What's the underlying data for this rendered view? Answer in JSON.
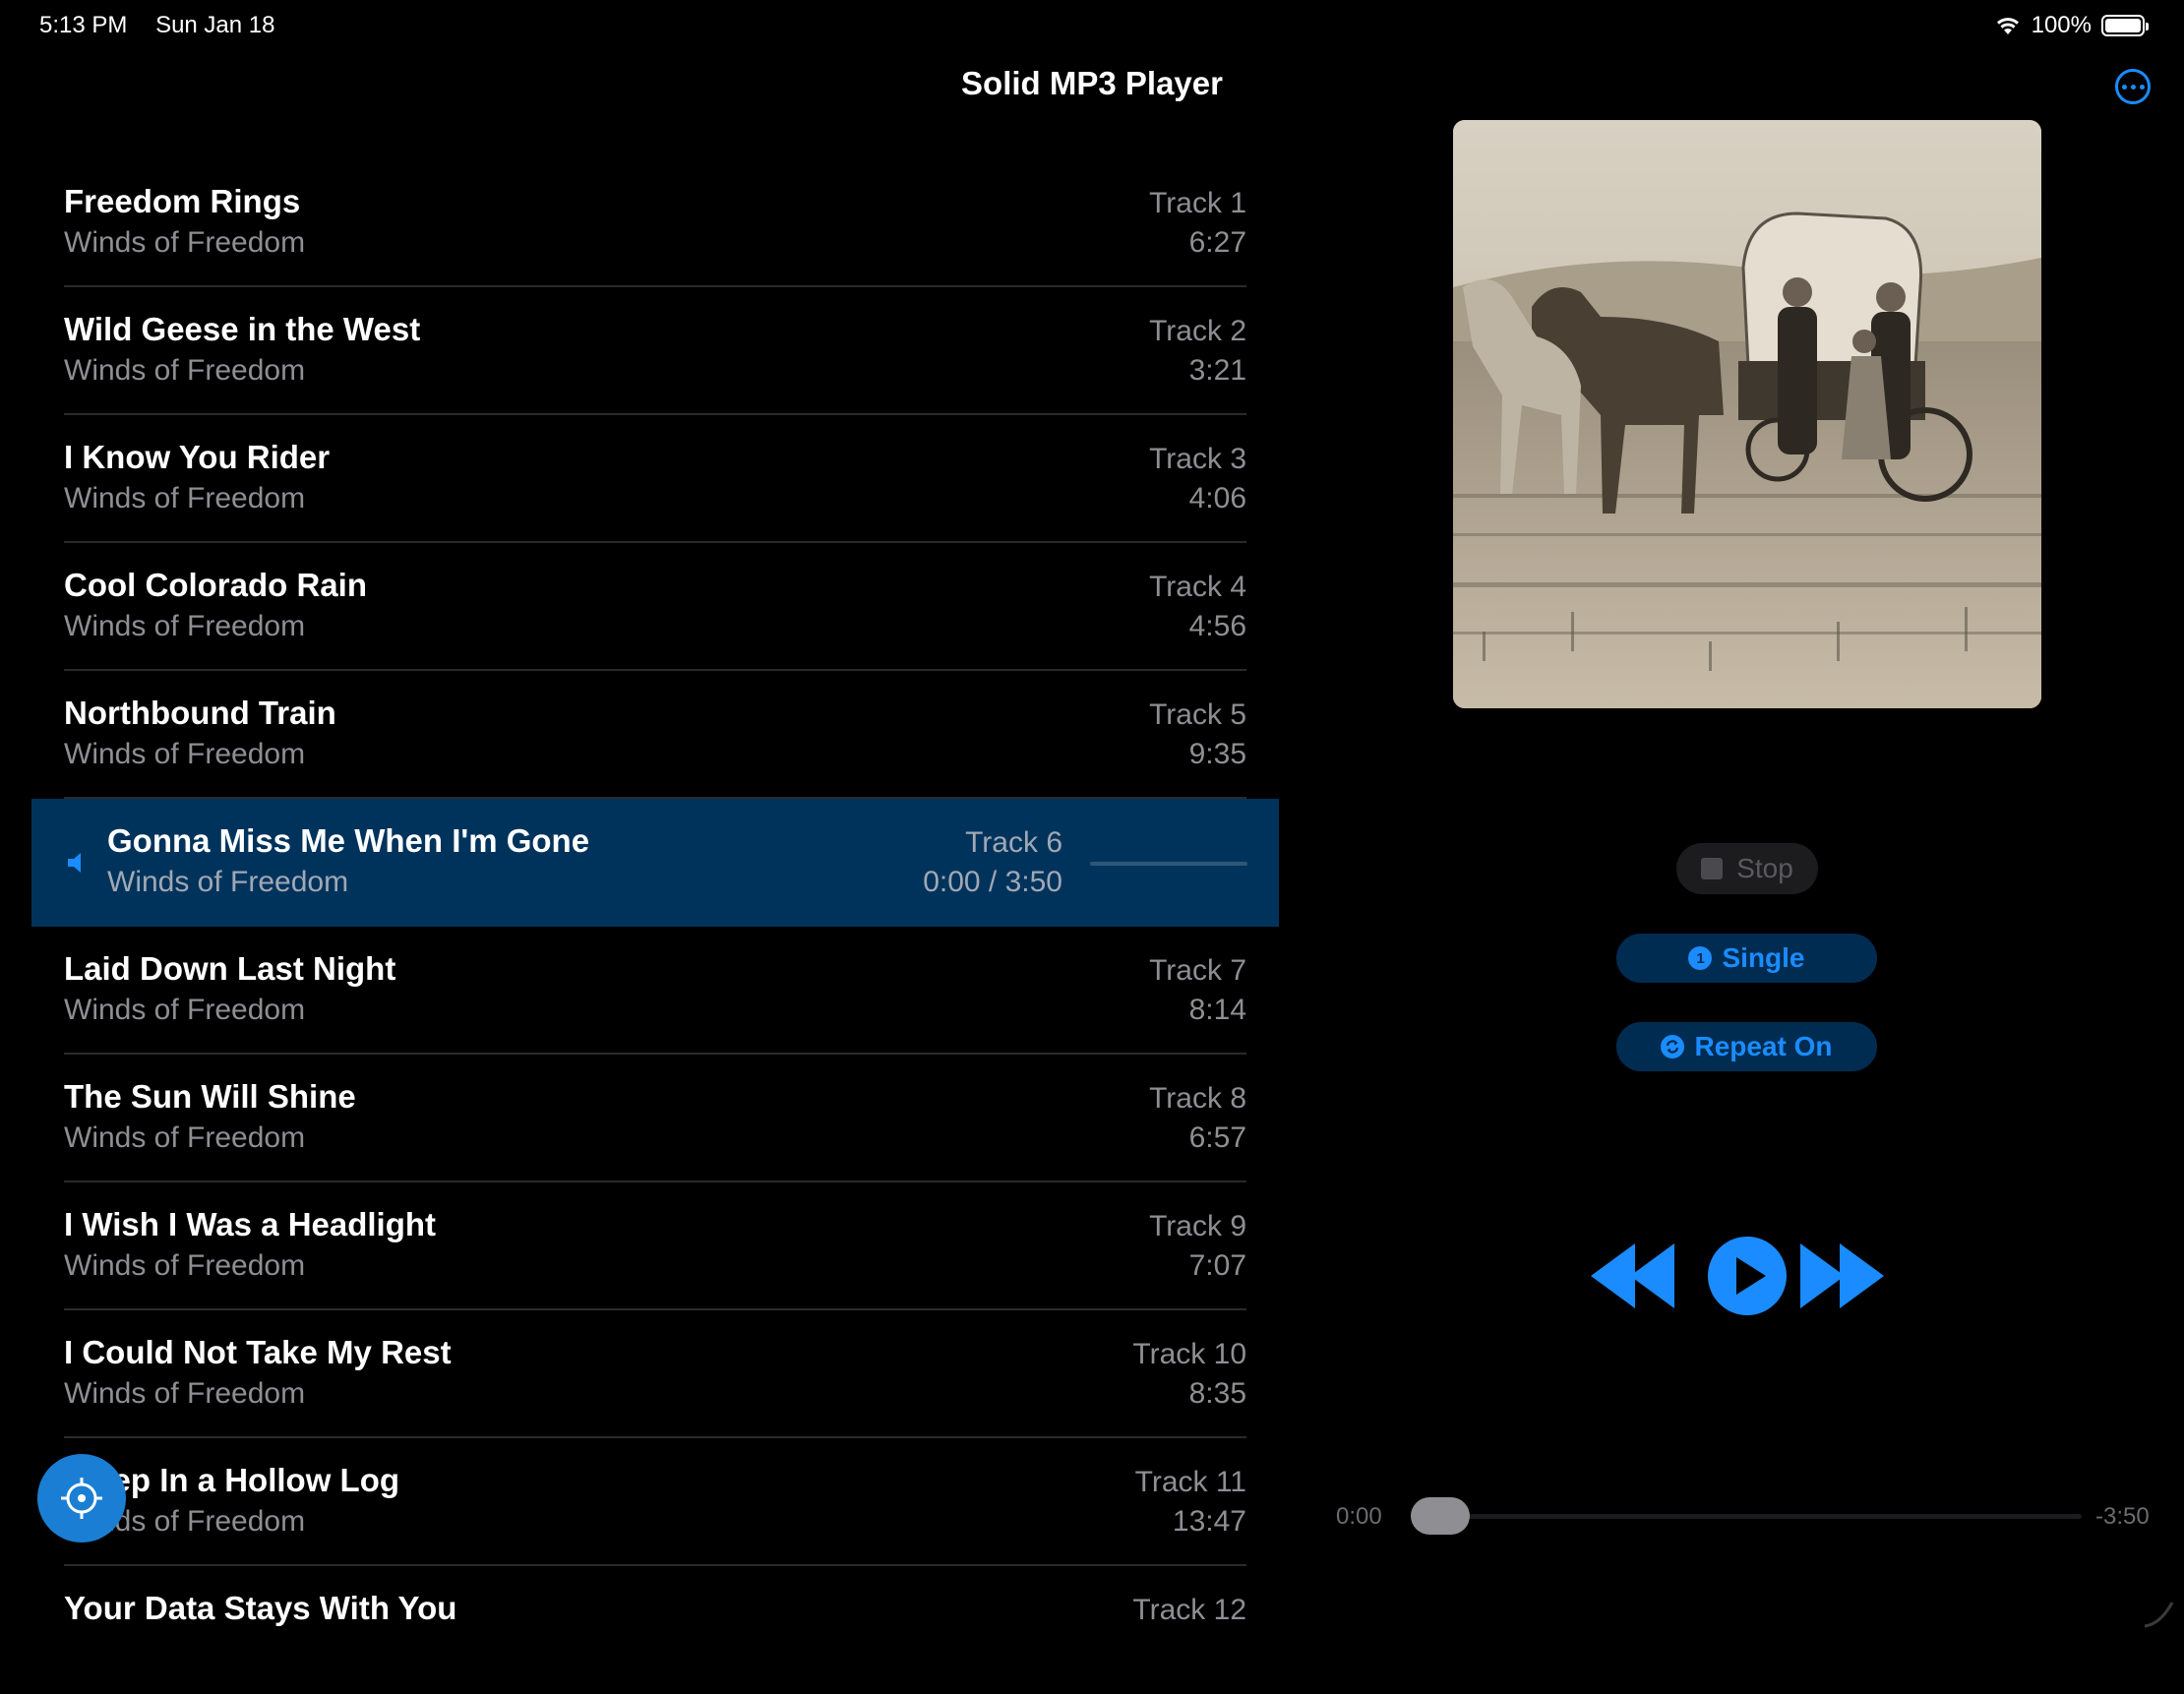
{
  "status": {
    "time": "5:13 PM",
    "date": "Sun Jan 18",
    "battery": "100%"
  },
  "nav": {
    "title": "Solid MP3 Player"
  },
  "tracks": [
    {
      "title": "Freedom Rings",
      "artist": "Winds of Freedom",
      "track": "Track 1",
      "duration": "6:27"
    },
    {
      "title": "Wild Geese in the West",
      "artist": "Winds of Freedom",
      "track": "Track 2",
      "duration": "3:21"
    },
    {
      "title": "I Know You Rider",
      "artist": "Winds of Freedom",
      "track": "Track 3",
      "duration": "4:06"
    },
    {
      "title": "Cool Colorado Rain",
      "artist": "Winds of Freedom",
      "track": "Track 4",
      "duration": "4:56"
    },
    {
      "title": "Northbound Train",
      "artist": "Winds of Freedom",
      "track": "Track 5",
      "duration": "9:35"
    },
    {
      "title": "Gonna Miss Me When I'm Gone",
      "artist": "Winds of Freedom",
      "track": "Track 6",
      "duration": "0:00 / 3:50",
      "playing": true
    },
    {
      "title": "Laid Down Last Night",
      "artist": "Winds of Freedom",
      "track": "Track 7",
      "duration": "8:14"
    },
    {
      "title": "The Sun Will Shine",
      "artist": "Winds of Freedom",
      "track": "Track 8",
      "duration": "6:57"
    },
    {
      "title": "I Wish I Was a Headlight",
      "artist": "Winds of Freedom",
      "track": "Track 9",
      "duration": "7:07"
    },
    {
      "title": "I Could Not Take My Rest",
      "artist": "Winds of Freedom",
      "track": "Track 10",
      "duration": "8:35"
    },
    {
      "title": "Sleep In a Hollow Log",
      "artist": "Winds of Freedom",
      "track": "Track 11",
      "duration": "13:47"
    },
    {
      "title": "Your Data Stays With You",
      "artist": "",
      "track": "Track 12",
      "duration": ""
    }
  ],
  "controls": {
    "stop_label": "Stop",
    "single_label": "Single",
    "single_icon_glyph": "1",
    "repeat_label": "Repeat On"
  },
  "scrubber": {
    "elapsed": "0:00",
    "remaining": "-3:50",
    "progress": 0.0
  },
  "colors": {
    "accent": "#1a8cff",
    "active_row": "#00335c",
    "secondary_text": "#8e8e93"
  }
}
